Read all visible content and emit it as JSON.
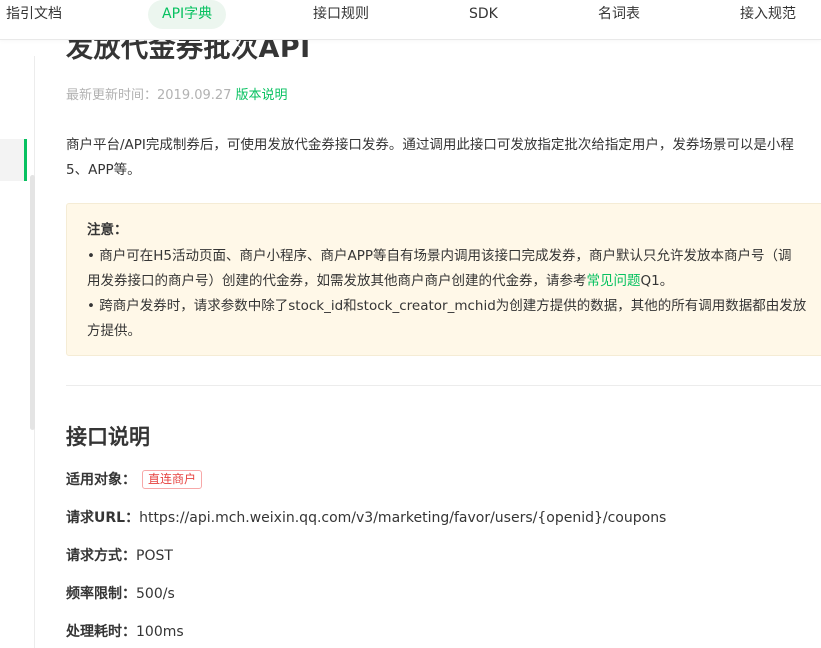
{
  "nav": {
    "items": [
      {
        "label": "指引文档"
      },
      {
        "label": "API字典"
      },
      {
        "label": "接口规则"
      },
      {
        "label": "SDK"
      },
      {
        "label": "名词表"
      },
      {
        "label": "接入规范"
      }
    ],
    "active_index": 1
  },
  "page": {
    "title": "发放代金券批次API",
    "updated_label": "最新更新时间：2019.09.27",
    "version_link": "版本说明",
    "intro_line1": "商户平台/API完成制券后，可使用发放代金券接口发券。通过调用此接口可发放指定批次给指定用户，发券场景可以是小程",
    "intro_line2": "5、APP等。"
  },
  "notice": {
    "title": "注意：",
    "line1": "• 商户可在H5活动页面、商户小程序、商户APP等自有场景内调用该接口完成发券，商户默认只允许发放本商户号（调",
    "line2_before": "用发券接口的商户号）创建的代金券，如需发放其他商户商户创建的代金券，请参考",
    "line2_link": "常见问题",
    "line2_after": "Q1。",
    "line3": "• 跨商户发券时，请求参数中除了stock_id和stock_creator_mchid为创建方提供的数据，其他的所有调用数据都由发放",
    "line4": "方提供。"
  },
  "interface": {
    "section_title": "接口说明",
    "applicable_key": "适用对象：",
    "applicable_tag": "直连商户",
    "url_key": "请求URL：",
    "url_value": "https://api.mch.weixin.qq.com/v3/marketing/favor/users/{openid}/coupons",
    "method_key": "请求方式：",
    "method_value": "POST",
    "rate_key": "频率限制：",
    "rate_value": "500/s",
    "time_key": "处理耗时：",
    "time_value": "100ms"
  },
  "colors": {
    "accent": "#07c160",
    "notice_bg": "#fff8e8",
    "tag_red": "#e64340"
  }
}
